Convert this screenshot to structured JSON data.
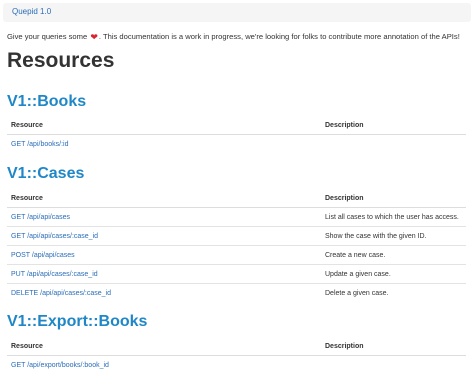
{
  "breadcrumb": {
    "label": "Quepid 1.0"
  },
  "intro": {
    "before": "Give your queries some",
    "heart_icon": "heart-icon",
    "heart_color": "#d9262e",
    "after": ". This documentation is a work in progress, we're looking for folks to contribute more annotation of the APIs!"
  },
  "page_title": "Resources",
  "link_color": "#2a6db8",
  "section_color": "#1f87c7",
  "sections": [
    {
      "title": "V1::Books",
      "headers": {
        "resource": "Resource",
        "description": "Description"
      },
      "rows": [
        {
          "resource": "GET /api/books/:id",
          "description": ""
        }
      ]
    },
    {
      "title": "V1::Cases",
      "headers": {
        "resource": "Resource",
        "description": "Description"
      },
      "rows": [
        {
          "resource": "GET /api/api/cases",
          "description": "List all cases to which the user has access."
        },
        {
          "resource": "GET /api/api/cases/:case_id",
          "description": "Show the case with the given ID."
        },
        {
          "resource": "POST /api/api/cases",
          "description": "Create a new case."
        },
        {
          "resource": "PUT /api/api/cases/:case_id",
          "description": "Update a given case."
        },
        {
          "resource": "DELETE /api/api/cases/:case_id",
          "description": "Delete a given case."
        }
      ]
    },
    {
      "title": "V1::Export::Books",
      "headers": {
        "resource": "Resource",
        "description": "Description"
      },
      "rows": [
        {
          "resource": "GET /api/export/books/:book_id",
          "description": ""
        }
      ]
    }
  ]
}
